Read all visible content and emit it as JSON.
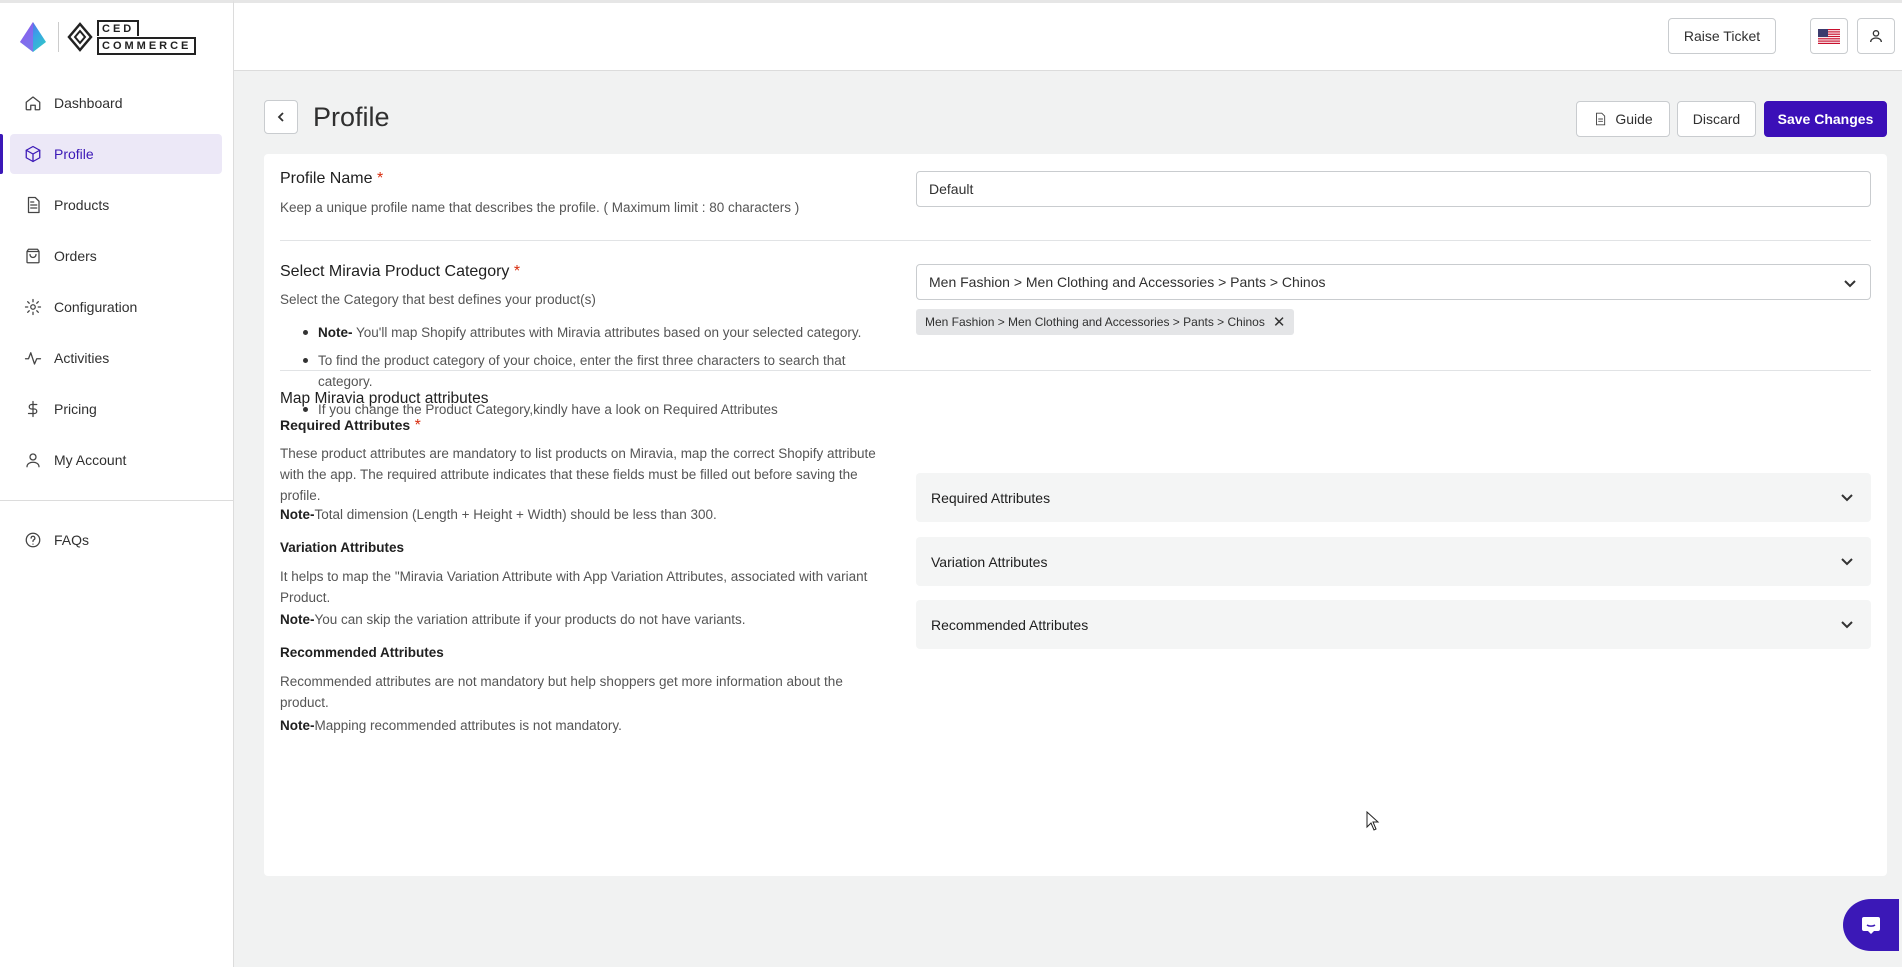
{
  "brand": {
    "logo_text_top": "CED",
    "logo_text_bottom": "COMMERCE"
  },
  "sidebar": {
    "items": [
      {
        "label": "Dashboard",
        "icon": "home-icon"
      },
      {
        "label": "Profile",
        "icon": "cube-icon",
        "active": true
      },
      {
        "label": "Products",
        "icon": "document-icon"
      },
      {
        "label": "Orders",
        "icon": "bag-icon"
      },
      {
        "label": "Configuration",
        "icon": "gear-icon"
      },
      {
        "label": "Activities",
        "icon": "activity-icon"
      },
      {
        "label": "Pricing",
        "icon": "dollar-icon"
      },
      {
        "label": "My Account",
        "icon": "user-icon"
      }
    ],
    "faq": {
      "label": "FAQs",
      "icon": "question-circle-icon"
    }
  },
  "topbar": {
    "raise_ticket": "Raise Ticket",
    "flag_icon": "us-flag-icon",
    "user_icon": "user-icon"
  },
  "header": {
    "title": "Profile",
    "guide": "Guide",
    "discard": "Discard",
    "save": "Save Changes"
  },
  "profile_name": {
    "title": "Profile Name",
    "required_mark": "*",
    "description": "Keep a unique profile name that describes the profile. ( Maximum limit : 80 characters )",
    "value": "Default"
  },
  "category": {
    "title": "Select Miravia Product Category",
    "required_mark": "*",
    "description": "Select the Category that best defines your product(s)",
    "notes": [
      {
        "bold": "Note-",
        "text": " You'll map Shopify attributes with Miravia attributes based on your selected category."
      },
      {
        "bold": "",
        "text": "To find the product category of your choice, enter the first three characters to search that category."
      },
      {
        "bold": "",
        "text": "If you change the Product Category,kindly have a look on Required Attributes"
      }
    ],
    "selected_value": "Men Fashion > Men Clothing and Accessories > Pants > Chinos",
    "tag": "Men Fashion > Men Clothing and Accessories > Pants > Chinos"
  },
  "attributes": {
    "title": "Map Miravia product attributes",
    "required": {
      "title": "Required Attributes",
      "required_mark": "*",
      "description": "These product attributes are mandatory to list products on Miravia, map the correct Shopify attribute with the app. The required attribute indicates that these fields must be filled out before saving the profile.",
      "note_bold": "Note-",
      "note": "Total dimension (Length + Height + Width) should be less than 300."
    },
    "variation": {
      "title": "Variation Attributes",
      "description": "It helps to map the \"Miravia Variation Attribute with App Variation Attributes, associated with variant Product.",
      "note_bold": "Note-",
      "note": "You can skip the variation attribute if your products do not have variants."
    },
    "recommended": {
      "title": "Recommended Attributes",
      "description": "Recommended attributes are not mandatory but help shoppers get more information about the product.",
      "note_bold": "Note-",
      "note": "Mapping recommended attributes is not mandatory."
    },
    "accordions": [
      "Required Attributes",
      "Variation Attributes",
      "Recommended Attributes"
    ]
  },
  "colors": {
    "accent": "#3b0fb8",
    "active_bg": "#ece8f7",
    "required": "#d82c0d"
  }
}
